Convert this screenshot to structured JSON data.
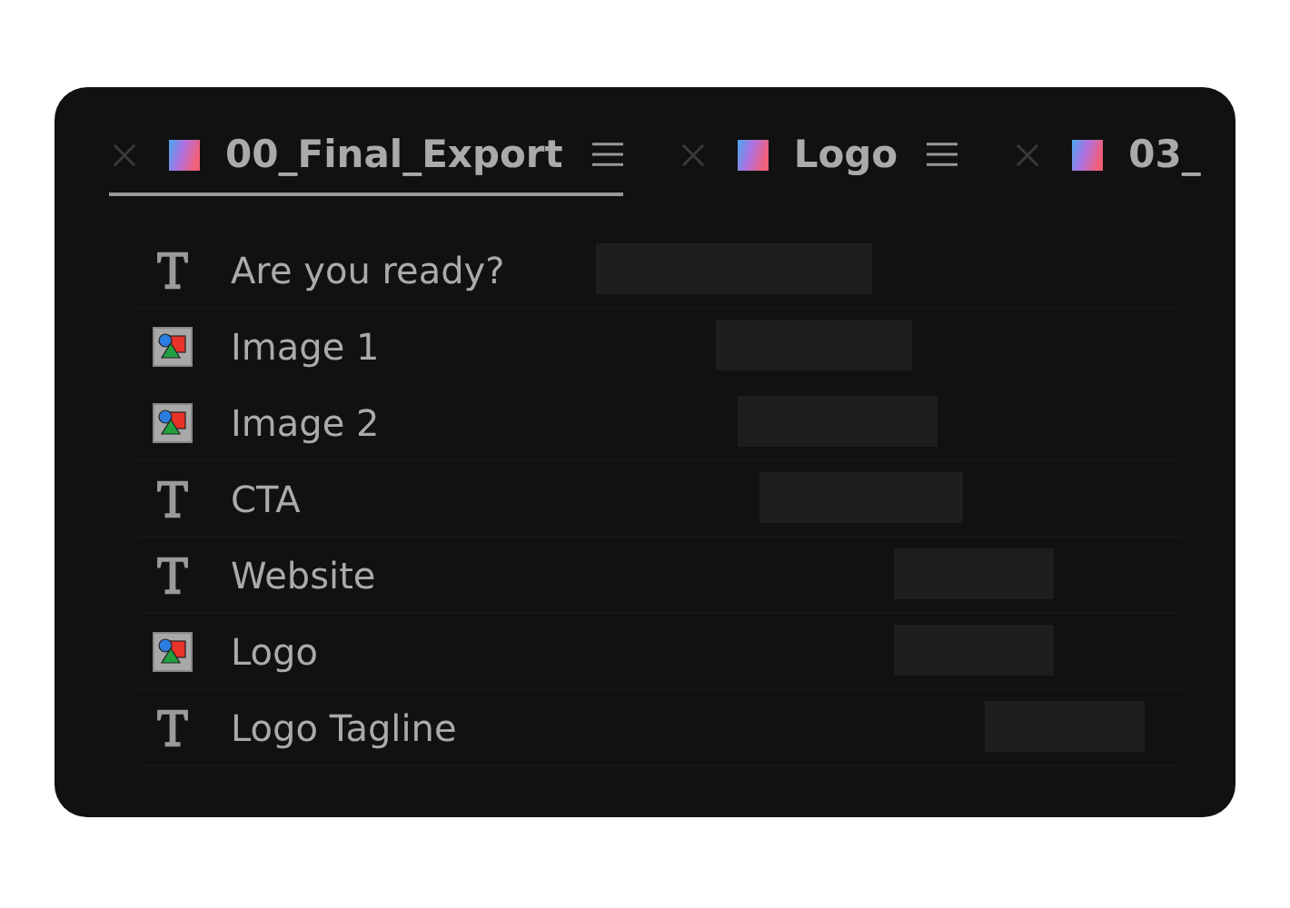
{
  "tabs": [
    {
      "label": "00_Final_Export",
      "selected": true
    },
    {
      "label": "Logo",
      "selected": false
    },
    {
      "label": "03_",
      "selected": false
    }
  ],
  "layers": [
    {
      "kind": "text",
      "name": "Are you ready?"
    },
    {
      "kind": "image",
      "name": "Image 1"
    },
    {
      "kind": "image",
      "name": "Image 2"
    },
    {
      "kind": "text",
      "name": "CTA"
    },
    {
      "kind": "text",
      "name": "Website"
    },
    {
      "kind": "image",
      "name": "Logo"
    },
    {
      "kind": "text",
      "name": "Logo Tagline"
    }
  ]
}
